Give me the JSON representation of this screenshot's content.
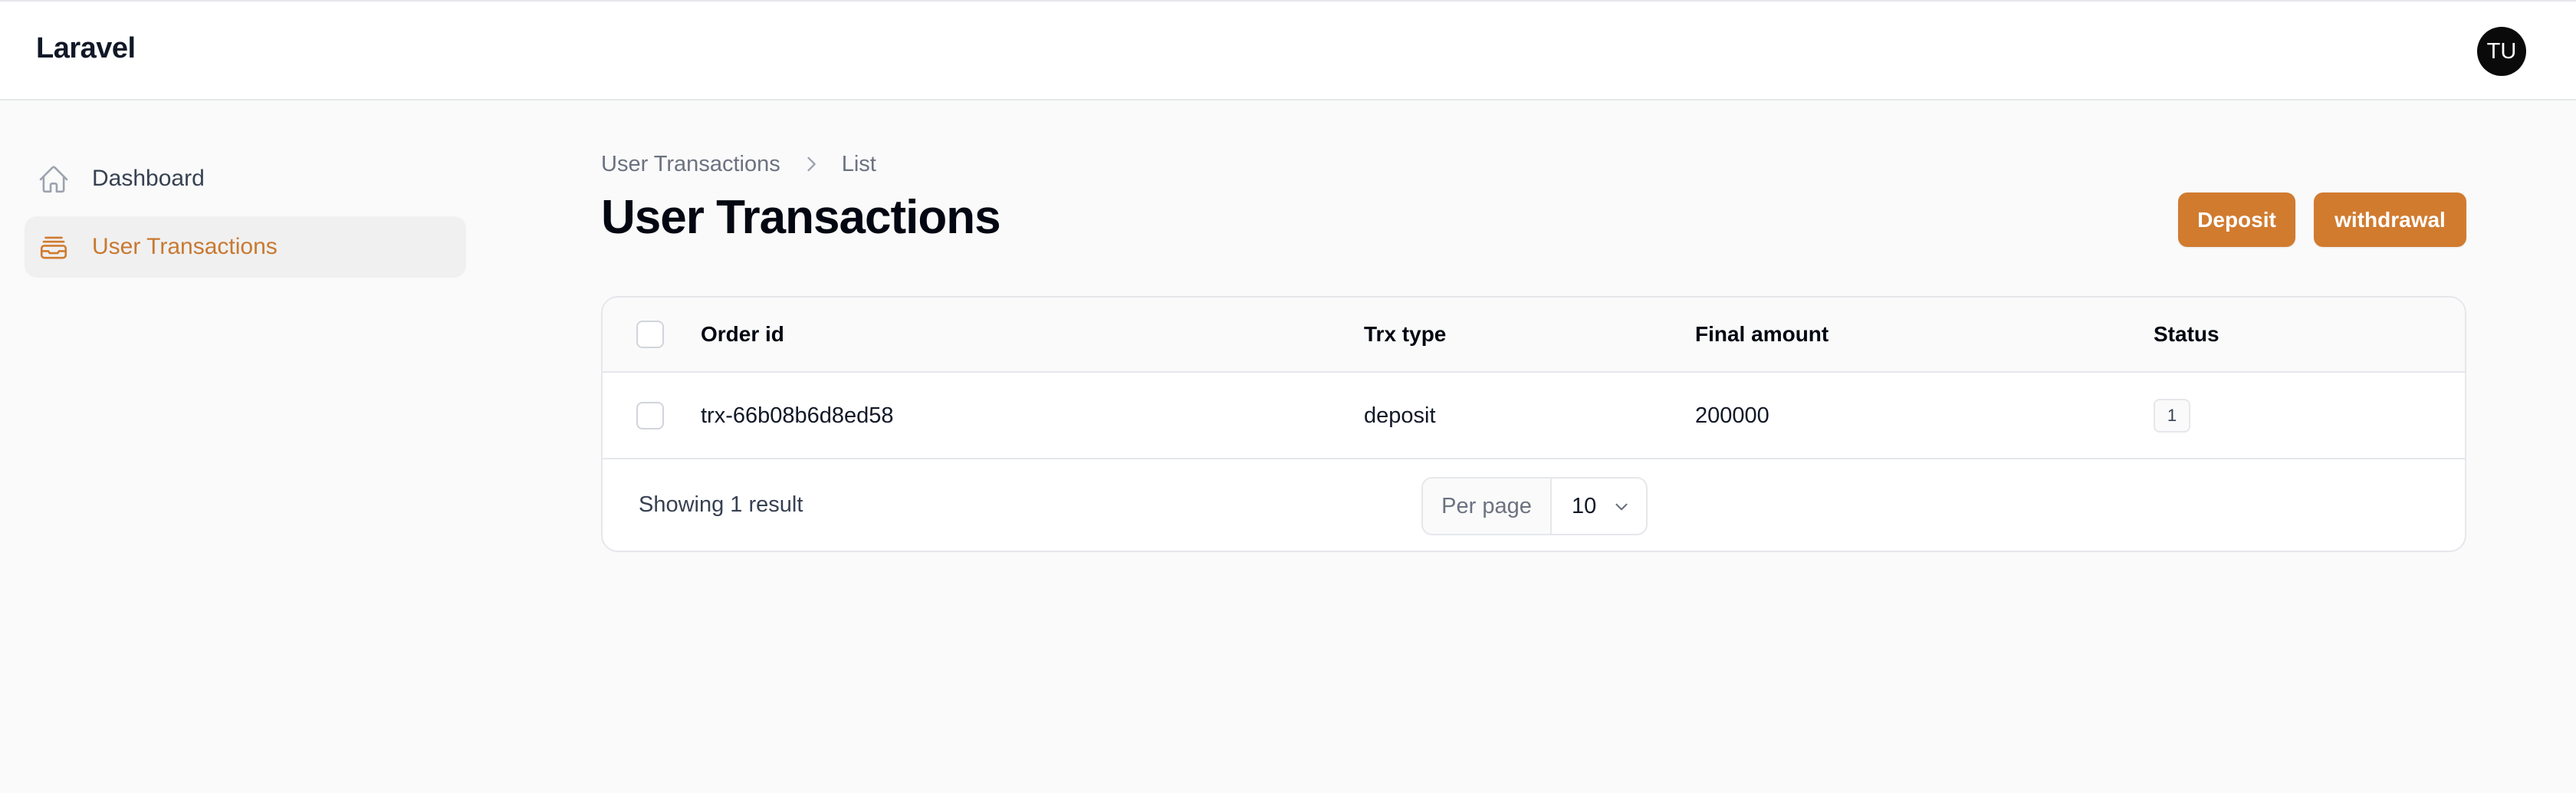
{
  "app": {
    "brand": "Laravel",
    "user_initials": "TU"
  },
  "sidebar": {
    "items": [
      {
        "label": "Dashboard",
        "icon": "home-icon",
        "active": false
      },
      {
        "label": "User Transactions",
        "icon": "archive-icon",
        "active": true
      }
    ]
  },
  "breadcrumb": {
    "items": [
      "User Transactions",
      "List"
    ]
  },
  "header": {
    "title": "User Transactions",
    "actions": {
      "deposit_label": "Deposit",
      "withdrawal_label": "withdrawal"
    }
  },
  "table": {
    "columns": [
      "Order id",
      "Trx type",
      "Final amount",
      "Status"
    ],
    "rows": [
      {
        "order_id": "trx-66b08b6d8ed58",
        "trx_type": "deposit",
        "final_amount": "200000",
        "status": "1"
      }
    ],
    "footer": {
      "summary": "Showing 1 result",
      "per_page_label": "Per page",
      "per_page_value": "10"
    }
  },
  "colors": {
    "accent": "#d17b2f",
    "active_nav": "#c8792f"
  }
}
